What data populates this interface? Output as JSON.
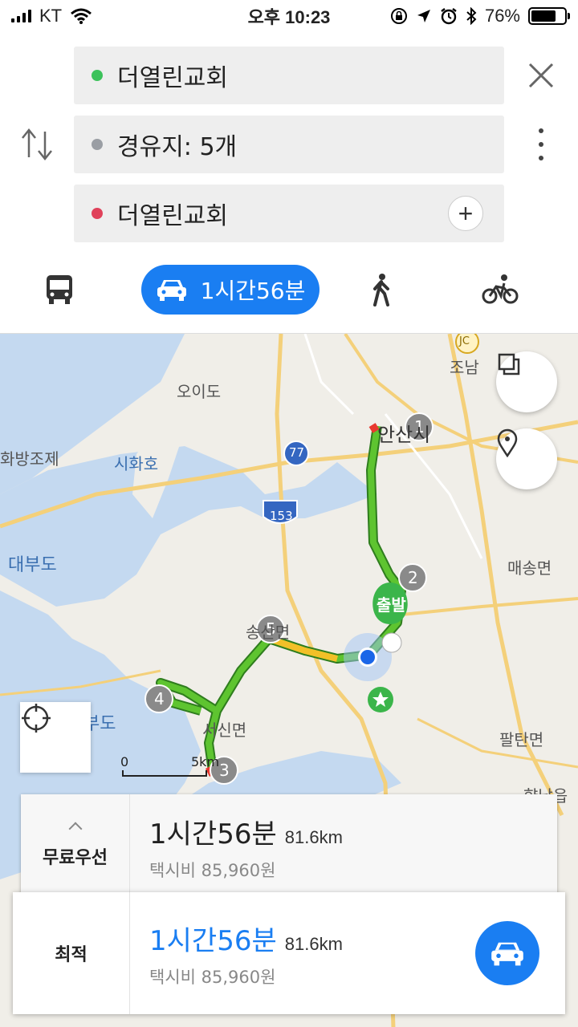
{
  "status_bar": {
    "carrier": "KT",
    "time": "오후 10:23",
    "battery": "76%",
    "battery_level": 0.76
  },
  "route": {
    "origin": "더열린교회",
    "waypoints": "경유지: 5개",
    "destination": "더열린교회"
  },
  "modes": {
    "car_duration": "1시간56분"
  },
  "map": {
    "place_labels": [
      "조남",
      "오이도",
      "안산시",
      "시화호",
      "대부도",
      "매송면",
      "서신면",
      "팔탄면",
      "송산면",
      "부도",
      "향남읍",
      "화방조제"
    ],
    "road_badges": [
      "77",
      "153",
      "JC"
    ],
    "waypoint_markers": [
      "1",
      "2",
      "3",
      "4",
      "5"
    ],
    "start_pin": "출발",
    "scale": {
      "start": "0",
      "end": "5km"
    },
    "colors": {
      "route_green": "#5ec430",
      "route_yellow": "#f2c028",
      "route_red": "#e8382f",
      "current_location": "#1a66e8",
      "water": "#c4d9f0"
    }
  },
  "results": {
    "free": {
      "label": "무료우선",
      "duration": "1시간56분",
      "distance": "81.6km",
      "fare": "택시비 85,960원"
    },
    "optimal": {
      "label": "최적",
      "duration": "1시간56분",
      "distance": "81.6km",
      "fare": "택시비 85,960원"
    }
  },
  "icons": [
    "signal-icon",
    "wifi-icon",
    "lock-rotation-icon",
    "location-arrow-icon",
    "alarm-icon",
    "bluetooth-icon",
    "battery-icon",
    "close-icon",
    "swap-icon",
    "more-icon",
    "plus-icon",
    "bus-icon",
    "car-icon",
    "walk-icon",
    "bike-icon",
    "layers-icon",
    "pin-icon",
    "crosshair-icon"
  ],
  "accent_color": "#1a7ef2"
}
